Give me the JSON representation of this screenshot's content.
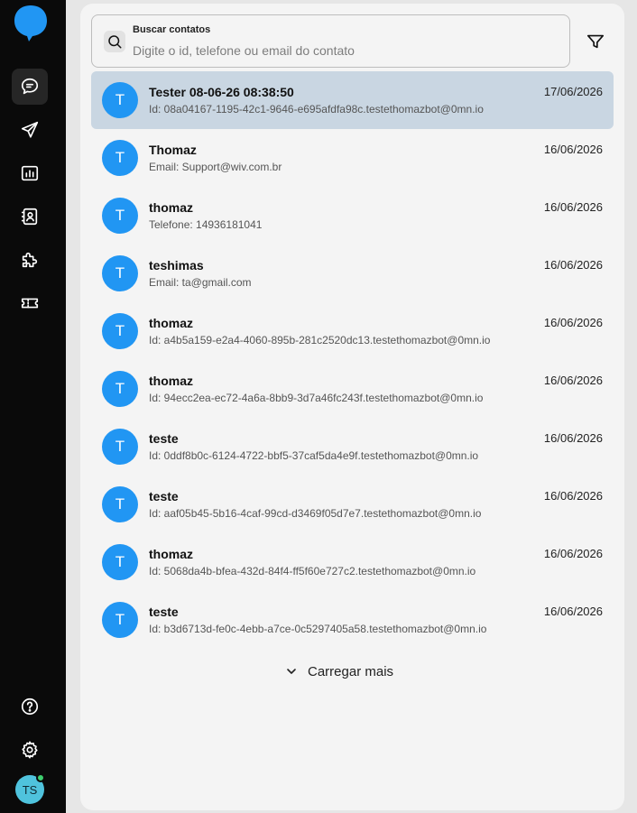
{
  "app": {
    "accent_color": "#2196f3",
    "selected_row_color": "#c9d6e2"
  },
  "sidebar": {
    "top_items": [
      {
        "icon": "chat-icon"
      },
      {
        "icon": "send-icon"
      },
      {
        "icon": "chart-icon"
      },
      {
        "icon": "contacts-icon"
      },
      {
        "icon": "puzzle-icon"
      },
      {
        "icon": "ticket-icon"
      }
    ],
    "bottom_items": [
      {
        "icon": "help-icon"
      },
      {
        "icon": "gear-icon"
      }
    ],
    "user_initials": "TS"
  },
  "search": {
    "label": "Buscar contatos",
    "placeholder": "Digite o id, telefone ou email do contato",
    "value": ""
  },
  "contacts": [
    {
      "initial": "T",
      "name": "Tester 08-06-26 08:38:50",
      "detail": "Id: 08a04167-1195-42c1-9646-e695afdfa98c.testethomazbot@0mn.io",
      "date": "17/06/2026",
      "selected": true
    },
    {
      "initial": "T",
      "name": "Thomaz",
      "detail": "Email: Support@wiv.com.br",
      "date": "16/06/2026"
    },
    {
      "initial": "T",
      "name": "thomaz",
      "detail": "Telefone: 14936181041",
      "date": "16/06/2026"
    },
    {
      "initial": "T",
      "name": "teshimas",
      "detail": "Email: ta@gmail.com",
      "date": "16/06/2026"
    },
    {
      "initial": "T",
      "name": "thomaz",
      "detail": "Id: a4b5a159-e2a4-4060-895b-281c2520dc13.testethomazbot@0mn.io",
      "date": "16/06/2026"
    },
    {
      "initial": "T",
      "name": "thomaz",
      "detail": "Id: 94ecc2ea-ec72-4a6a-8bb9-3d7a46fc243f.testethomazbot@0mn.io",
      "date": "16/06/2026"
    },
    {
      "initial": "T",
      "name": "teste",
      "detail": "Id: 0ddf8b0c-6124-4722-bbf5-37caf5da4e9f.testethomazbot@0mn.io",
      "date": "16/06/2026"
    },
    {
      "initial": "T",
      "name": "teste",
      "detail": "Id: aaf05b45-5b16-4caf-99cd-d3469f05d7e7.testethomazbot@0mn.io",
      "date": "16/06/2026"
    },
    {
      "initial": "T",
      "name": "thomaz",
      "detail": "Id: 5068da4b-bfea-432d-84f4-ff5f60e727c2.testethomazbot@0mn.io",
      "date": "16/06/2026"
    },
    {
      "initial": "T",
      "name": "teste",
      "detail": "Id: b3d6713d-fe0c-4ebb-a7ce-0c5297405a58.testethomazbot@0mn.io",
      "date": "16/06/2026"
    }
  ],
  "load_more": {
    "label": "Carregar mais"
  }
}
